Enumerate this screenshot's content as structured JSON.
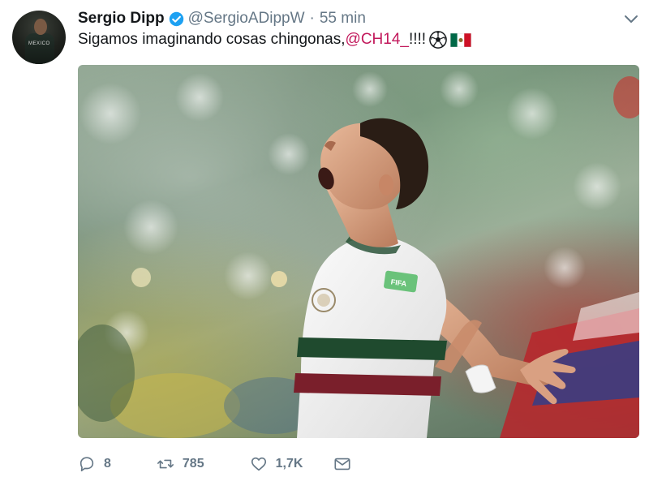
{
  "tweet": {
    "author": {
      "name": "Sergio Dipp",
      "handle": "@SergioADippW",
      "verified": true,
      "avatar_icon": "avatar",
      "avatar_text": "MEXICO"
    },
    "separator": "·",
    "time": "55 min",
    "text": {
      "before": "Sigamos imaginando cosas chingonas, ",
      "mention": "@CH14_",
      "after": "!!!!",
      "emoji": [
        "soccer-ball-icon",
        "mexico-flag-icon"
      ]
    },
    "media": {
      "icon": "photo",
      "jersey_patch": "FIFA"
    },
    "actions": {
      "reply": {
        "icon": "reply-icon",
        "count": "8"
      },
      "retweet": {
        "icon": "retweet-icon",
        "count": "785"
      },
      "like": {
        "icon": "heart-icon",
        "count": "1,7K"
      },
      "dm": {
        "icon": "envelope-icon"
      }
    },
    "colors": {
      "mention": "#c2185b",
      "muted": "#657786",
      "verified": "#1da1f2"
    }
  }
}
